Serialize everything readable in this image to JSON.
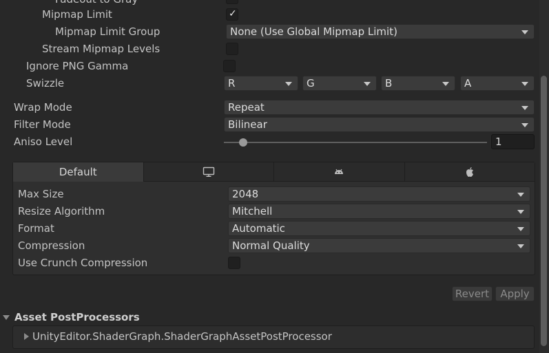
{
  "top_partial": {
    "label": "Fadeout to Gray"
  },
  "mipmap": {
    "limit_label": "Mipmap Limit",
    "limit_checked": true,
    "group_label": "Mipmap Limit Group",
    "group_value": "None (Use Global Mipmap Limit)",
    "stream_label": "Stream Mipmap Levels",
    "stream_checked": false
  },
  "png": {
    "label": "Ignore PNG Gamma",
    "checked": false
  },
  "swizzle": {
    "label": "Swizzle",
    "channels": [
      "R",
      "G",
      "B",
      "A"
    ]
  },
  "wrap": {
    "label": "Wrap Mode",
    "value": "Repeat"
  },
  "filter": {
    "label": "Filter Mode",
    "value": "Bilinear"
  },
  "aniso": {
    "label": "Aniso Level",
    "value": "1",
    "level_fraction": 0.06
  },
  "platform_tabs": {
    "default_label": "Default",
    "icons": [
      "monitor-icon",
      "android-icon",
      "apple-icon"
    ]
  },
  "platform_settings": {
    "max_size_label": "Max Size",
    "max_size_value": "2048",
    "resize_label": "Resize Algorithm",
    "resize_value": "Mitchell",
    "format_label": "Format",
    "format_value": "Automatic",
    "compression_label": "Compression",
    "compression_value": "Normal Quality",
    "crunch_label": "Use Crunch Compression",
    "crunch_checked": false
  },
  "actions": {
    "revert_label": "Revert",
    "apply_label": "Apply"
  },
  "postprocessors": {
    "header": "Asset PostProcessors",
    "items": [
      "UnityEditor.ShaderGraph.ShaderGraphAssetPostProcessor"
    ]
  },
  "colors": {
    "background": "#282828",
    "text": "#c4c4c4",
    "field": "#3b3b3b",
    "checkmark": "#e6e6e6"
  }
}
